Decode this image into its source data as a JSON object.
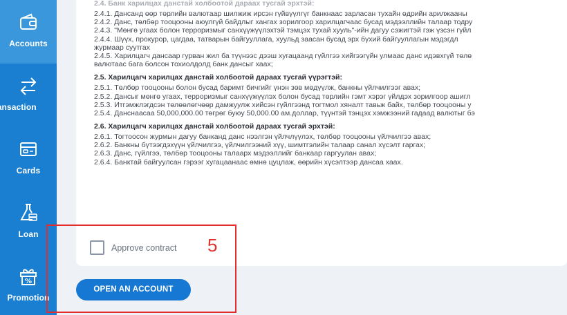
{
  "sidebar": {
    "items": [
      {
        "label": "Accounts",
        "icon": "wallet-icon"
      },
      {
        "label": "ransaction",
        "icon": "transfer-arrows-icon"
      },
      {
        "label": "Cards",
        "icon": "credit-card-icon"
      },
      {
        "label": "Loan",
        "icon": "money-flask-icon"
      },
      {
        "label": "Promotion",
        "icon": "gift-percent-icon"
      }
    ]
  },
  "contract": {
    "lines": [
      {
        "text": "2.4. Банк харилцах данстай холбоотой дараах тусгай эрхтэй:",
        "type": "faded-heading"
      },
      {
        "text": "2.4.1. Дансанд өөр төрлийн валютаар шилжиж ирсэн гүйвүүлгүг банкнаас зарласан тухайн өдрийн арилжааны",
        "type": "item"
      },
      {
        "text": "2.4.2. Данс, төлбөр тооцооны аюулгүй байдлыг хангах зорилгоор харилцагчаас бусад мэдээллийн талаар тодру",
        "type": "item"
      },
      {
        "text": "2.4.3. \"Мөнгө угаах болон терроризмыг санхүүжүүлэхтэй тэмцэх тухай хууль\"-ийн дагуу сэжигтэй гэж үзсэн гүйл",
        "type": "item"
      },
      {
        "text": "2.4.4. Шүүх, прокурор, цагдаа, татварын байгууллага, хуульд заасан бусад эрх бүхий байгууллагын мэдэгдл",
        "type": "item"
      },
      {
        "text": "журмаар суутгах",
        "type": "item"
      },
      {
        "text": "2.4.5. Харилцагч дансаар гурван жил ба түүнээс дээш хугацаанд гүйлгээ хийгээгүйн улмаас данс идэвхгүй төлө",
        "type": "item"
      },
      {
        "text": "валютаас бага болсон тохиолдолд банк дансыг хаах;",
        "type": "item"
      },
      {
        "text": "2.5. Харилцагч харилцах данстай холбоотой дараах тусгай үүрэгтэй:",
        "type": "heading"
      },
      {
        "text": "2.5.1. Төлбөр тооцооны болон бусад баримт бичгийг үнэн зөв мөдүүлж, банкны үйлчилгээг авах;",
        "type": "item"
      },
      {
        "text": "2.5.2. Дансыг мөнгө угаах, терроризмыг санхүүжүүлэх болон бусад төрлийн гэмт хэрэг үйлдэх зорилгоор ашигл",
        "type": "item"
      },
      {
        "text": "2.5.3. Итгэмжлэгдсэн төлөөлөгчөөр дамжуулж хийсэн гүйлгээнд тогтмол хяналт тавьж байх, төлбөр тооцооны у",
        "type": "item"
      },
      {
        "text": "2.5.4. Данснаасаа 50,000,000.00 төгрөг буюу 50,000.00 ам.доллар, түүнтэй тэнцэх хэмжээний гадаад валютыг бэ",
        "type": "item"
      },
      {
        "text": "2.6. Харилцагч харилцах данстай холбоотой дараах тусгай эрхтэй:",
        "type": "heading"
      },
      {
        "text": "2.6.1. Тогтоосон журмын дагуу банканд данс нээлгэн үйлчлүүлэх, төлбөр тооцооны үйлчилгээ авах;",
        "type": "item"
      },
      {
        "text": "2.6.2. Банкны бүтээгдэхүүн үйлчилгээ, үйлчилгээний хүү, шимтгэлийн талаар санал хүсэлт гаргах;",
        "type": "item"
      },
      {
        "text": "2.6.3. Данс, гүйлгээ, төлбөр тооцооны талаарх мэдээллийг банкаар гаргуулан авах;",
        "type": "item"
      },
      {
        "text": "2.6.4. Банктай байгуулсан гэрээг хугацаанаас өмнө цуцлаж, өөрийн хүсэлтээр дансаа хаах.",
        "type": "item"
      }
    ]
  },
  "approve": {
    "label": "Approve contract",
    "checked": false
  },
  "actions": {
    "open_account": "OPEN AN ACCOUNT"
  },
  "annotation": {
    "step": "5",
    "color": "#e52c2c"
  },
  "colors": {
    "sidebar": "#1a7fd0",
    "sidebar_active": "#3b97dc",
    "primary_button": "#1678d2"
  }
}
